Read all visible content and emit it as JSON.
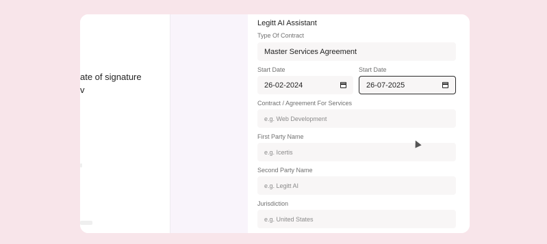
{
  "document": {
    "line1": "ate of signature",
    "line2": "v"
  },
  "assistant": {
    "title": "Legitt AI Assistant",
    "contract_type": {
      "label": "Type Of Contract",
      "value": "Master Services Agreement"
    },
    "start_date": {
      "label": "Start Date",
      "value": "26-02-2024"
    },
    "start_date_2": {
      "label": "Start Date",
      "value": "26-07-2025"
    },
    "services": {
      "label": "Contract / Agreement For Services",
      "placeholder": "e.g. Web Development"
    },
    "first_party": {
      "label": "First Party Name",
      "placeholder": "e.g. Icertis"
    },
    "second_party": {
      "label": "Second Party Name",
      "placeholder": "e.g. Legitt AI"
    },
    "jurisdiction": {
      "label": "Jurisdiction",
      "placeholder": "e.g. United States"
    }
  }
}
